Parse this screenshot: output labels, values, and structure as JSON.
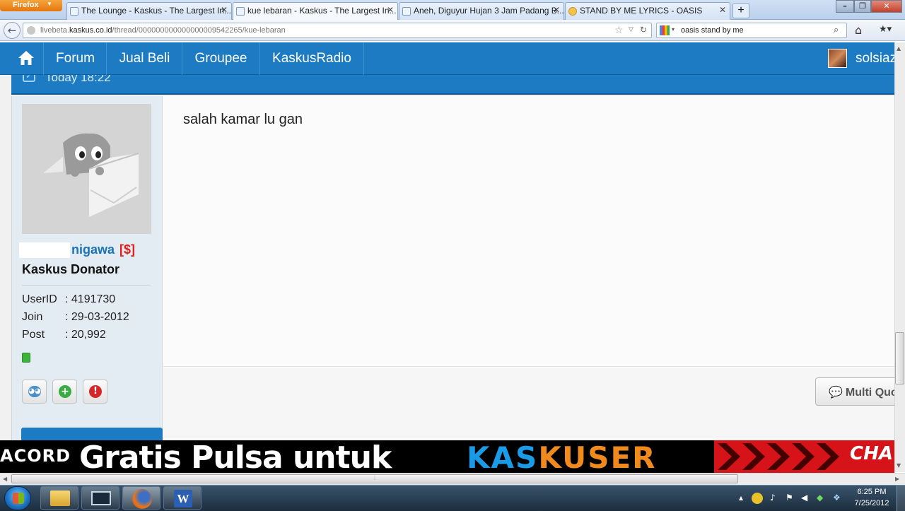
{
  "browser": {
    "menu_button": "Firefox",
    "tabs": [
      {
        "label": "The Lounge - Kaskus - The Largest In..."
      },
      {
        "label": "kue lebaran - Kaskus - The Largest In..."
      },
      {
        "label": "Aneh, Diguyur Hujan 3 Jam Padang B..."
      },
      {
        "label": "STAND BY ME LYRICS - OASIS"
      }
    ],
    "new_tab": "+",
    "url_prefix": "livebeta.",
    "url_domain": "kaskus.co.id",
    "url_path": "/thread/000000000000000009542265/kue-lebaran",
    "search_value": "oasis stand by me"
  },
  "site_nav": {
    "items": [
      "Forum",
      "Jual Beli",
      "Groupee",
      "KaskusRadio"
    ],
    "username": "solsiaz"
  },
  "post": {
    "time": "Today 18:22",
    "message": "salah kamar lu gan",
    "multi_quote": "Multi Quote"
  },
  "user": {
    "name": "nigawa",
    "donator_mark": "[$]",
    "title": "Kaskus Donator",
    "fields": [
      {
        "label": "UserID",
        "value": ": 4191730"
      },
      {
        "label": "Join",
        "value": ": 29-03-2012"
      },
      {
        "label": "Post",
        "value": ": 20,992"
      }
    ]
  },
  "banner": {
    "left": "ACORD",
    "main": "Gratis Pulsa untuk",
    "kaskuser_blue": "KAS",
    "kaskuser_orange": "KUSER",
    "right": "CHA"
  },
  "taskbar": {
    "time": "6:25 PM",
    "date": "7/25/2012"
  },
  "colors": {
    "kaskus_blue": "#1d7bc3",
    "username_blue": "#1a73b8",
    "donator_red": "#e0201e",
    "banner_red": "#d61318",
    "banner_orange": "#f18a1d"
  }
}
